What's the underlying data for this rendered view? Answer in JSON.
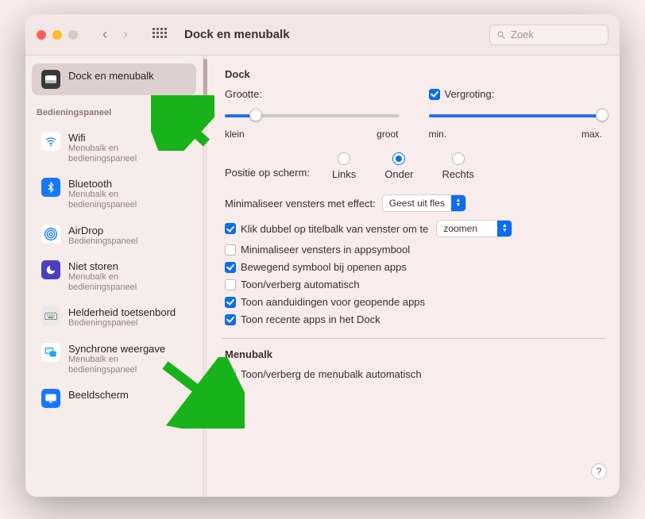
{
  "toolbar": {
    "title": "Dock en menubalk",
    "search_placeholder": "Zoek"
  },
  "sidebar": {
    "selected": {
      "title": "Dock en menubalk"
    },
    "section_header": "Bedieningspaneel",
    "items": [
      {
        "title": "Wifi",
        "sub": "Menubalk en bedieningspaneel",
        "icon": "wifi",
        "bg": "#ffffff",
        "fg": "#2a7bf6"
      },
      {
        "title": "Bluetooth",
        "sub": "Menubalk en bedieningspaneel",
        "icon": "bt",
        "bg": "#1677ff",
        "fg": "#ffffff"
      },
      {
        "title": "AirDrop",
        "sub": "Bedieningspaneel",
        "icon": "airdrop",
        "bg": "#ffffff",
        "fg": "#1677ff"
      },
      {
        "title": "Niet storen",
        "sub": "Menubalk en bedieningspaneel",
        "icon": "dnd",
        "bg": "#4b3fbf",
        "fg": "#ffffff"
      },
      {
        "title": "Helderheid toetsenbord",
        "sub": "Bedieningspaneel",
        "icon": "kbd",
        "bg": "#e9e9e9",
        "fg": "#555"
      },
      {
        "title": "Synchrone weergave",
        "sub": "Menubalk en bedieningspaneel",
        "icon": "mirror",
        "bg": "#ffffff",
        "fg": "#1aa2ff"
      },
      {
        "title": "Beeldscherm",
        "sub": "",
        "icon": "display",
        "bg": "#1677ff",
        "fg": "#ffffff"
      }
    ]
  },
  "dock": {
    "section": "Dock",
    "size_label": "Grootte:",
    "size_min": "klein",
    "size_max": "groot",
    "size_value_pct": 18,
    "magnification_label": "Vergroting:",
    "mag_min": "min.",
    "mag_max": "max.",
    "mag_value_pct": 100,
    "mag_checked": true,
    "position_label": "Positie op scherm:",
    "positions": [
      "Links",
      "Onder",
      "Rechts"
    ],
    "position_selected_index": 1,
    "minimize_effect_label": "Minimaliseer vensters met effect:",
    "minimize_effect_value": "Geest uit fles",
    "dblclick_label_prefix": "Klik dubbel op titelbalk van venster om te",
    "dblclick_value": "zoomen",
    "dblclick_checked": true,
    "options": [
      {
        "label": "Minimaliseer vensters in appsymbool",
        "checked": false
      },
      {
        "label": "Bewegend symbool bij openen apps",
        "checked": true
      },
      {
        "label": "Toon/verberg automatisch",
        "checked": false
      },
      {
        "label": "Toon aanduidingen voor geopende apps",
        "checked": true
      },
      {
        "label": "Toon recente apps in het Dock",
        "checked": true
      }
    ]
  },
  "menubar": {
    "section": "Menubalk",
    "auto_hide_label": "Toon/verberg de menubalk automatisch",
    "auto_hide_checked": false
  },
  "help_glyph": "?"
}
